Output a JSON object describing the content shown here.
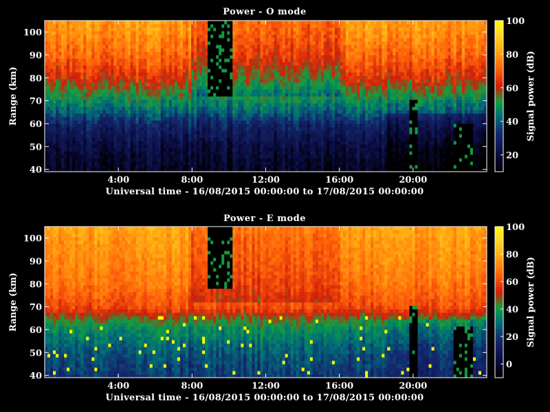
{
  "chart_data": [
    {
      "type": "heatmap",
      "title": "Power - O mode",
      "xlabel": "Universal time - 16/08/2015 00:00:00 to 17/08/2015 00:00:00",
      "ylabel": "Range (km)",
      "colorbar_label": "Signal power (dB)",
      "xlim_hours": [
        0,
        24
      ],
      "ylim_km": [
        39,
        105
      ],
      "x_ticks": [
        {
          "value": 4,
          "label": "4:00"
        },
        {
          "value": 8,
          "label": "8:00"
        },
        {
          "value": 12,
          "label": "12:00"
        },
        {
          "value": 16,
          "label": "16:00"
        },
        {
          "value": 20,
          "label": "20:00"
        }
      ],
      "y_ticks": [
        40,
        50,
        60,
        70,
        80,
        90,
        100
      ],
      "colorbar_ticks": [
        20,
        40,
        60,
        80,
        100
      ],
      "clim_db": [
        10,
        100
      ],
      "profile_note_unused": "",
      "range_profile_db": [
        {
          "range_km": 40,
          "power_db": 15
        },
        {
          "range_km": 50,
          "power_db": 20
        },
        {
          "range_km": 60,
          "power_db": 30
        },
        {
          "range_km": 65,
          "power_db": 40
        },
        {
          "range_km": 70,
          "power_db": 47
        },
        {
          "range_km": 75,
          "power_db": 55
        },
        {
          "range_km": 80,
          "power_db": 62
        },
        {
          "range_km": 90,
          "power_db": 72
        },
        {
          "range_km": 100,
          "power_db": 78
        },
        {
          "range_km": 105,
          "power_db": 80
        }
      ],
      "gaps": [
        {
          "t_start": 8.8,
          "t_end": 10.2,
          "range_min_km": 72,
          "range_max_km": 105
        },
        {
          "t_start": 19.8,
          "t_end": 20.2,
          "range_min_km": 39,
          "range_max_km": 70
        },
        {
          "t_start": 22.2,
          "t_end": 23.2,
          "range_min_km": 39,
          "range_max_km": 60
        }
      ]
    },
    {
      "type": "heatmap",
      "title": "Power - E mode",
      "xlabel": "Universal time - 16/08/2015 00:00:00 to 17/08/2015 00:00:00",
      "ylabel": "Range (km)",
      "colorbar_label": "Signal power (dB)",
      "xlim_hours": [
        0,
        24
      ],
      "ylim_km": [
        39,
        105
      ],
      "x_ticks": [
        {
          "value": 4,
          "label": "4:00"
        },
        {
          "value": 8,
          "label": "8:00"
        },
        {
          "value": 12,
          "label": "12:00"
        },
        {
          "value": 16,
          "label": "16:00"
        },
        {
          "value": 20,
          "label": "20:00"
        }
      ],
      "y_ticks": [
        40,
        50,
        60,
        70,
        80,
        90,
        100
      ],
      "colorbar_ticks": [
        0,
        20,
        40,
        60,
        80,
        100
      ],
      "clim_db": [
        -10,
        100
      ],
      "range_profile_db": [
        {
          "range_km": 40,
          "power_db": 20
        },
        {
          "range_km": 50,
          "power_db": 25
        },
        {
          "range_km": 60,
          "power_db": 35
        },
        {
          "range_km": 65,
          "power_db": 45
        },
        {
          "range_km": 70,
          "power_db": 60
        },
        {
          "range_km": 80,
          "power_db": 68
        },
        {
          "range_km": 90,
          "power_db": 72
        },
        {
          "range_km": 100,
          "power_db": 75
        },
        {
          "range_km": 105,
          "power_db": 78
        }
      ],
      "gaps": [
        {
          "t_start": 8.8,
          "t_end": 10.2,
          "range_min_km": 78,
          "range_max_km": 105
        },
        {
          "t_start": 19.8,
          "t_end": 20.2,
          "range_min_km": 39,
          "range_max_km": 70
        },
        {
          "t_start": 22.2,
          "t_end": 23.2,
          "range_min_km": 39,
          "range_max_km": 62
        }
      ]
    }
  ]
}
